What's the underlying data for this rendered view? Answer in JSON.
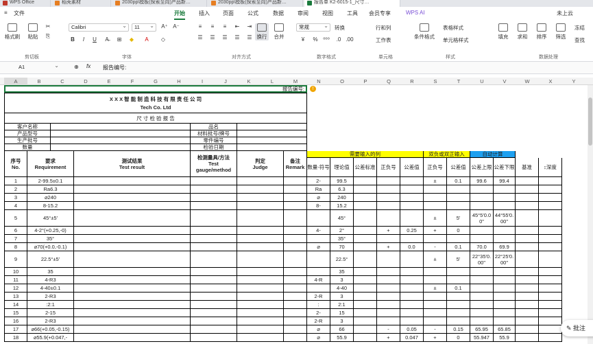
{
  "tabs": [
    {
      "label": "WPS Office",
      "color": "#c0392b"
    },
    {
      "label": "稻壳素材",
      "color": "#e67e22"
    },
    {
      "label": "2030pp\\模板(探索至向)产品新…",
      "color": "#e67e22"
    },
    {
      "label": "2030pp\\模板(探索至向)产品新…",
      "color": "#e67e22"
    },
    {
      "label": "报告单 K2-6015-1_尺寸…",
      "color": "#1a7a3c"
    }
  ],
  "menu": {
    "file": "文件",
    "items": [
      "开始",
      "插入",
      "页面",
      "公式",
      "数据",
      "审阅",
      "视图",
      "工具",
      "会员专享"
    ],
    "ai": "WPS AI",
    "cloud": "未上云",
    "active": "开始"
  },
  "ribbon": {
    "paste_group": [
      "格式刷",
      "粘贴",
      "剪切板"
    ],
    "font_name": "Calibri",
    "font_size": "11",
    "font_group": "字体",
    "align": [
      "换行",
      "合并",
      "对齐方式"
    ],
    "number_format": "常规",
    "convert": "转换",
    "rows_cols": "行和列",
    "worksheet": "工作表",
    "cond_format": "条件格式",
    "table_style": "表格样式",
    "cell_style": "单元格样式",
    "number_group": "数字格式",
    "cell_group": "单元格",
    "style_group": "样式",
    "fill": "填充",
    "sum": "求和",
    "sort": "排序",
    "filter": "筛选",
    "freeze": "冻结",
    "find": "查找",
    "data_group": "数据处理"
  },
  "formula_bar": {
    "cell_ref": "A1",
    "fx": "fx",
    "content": "报告编号:"
  },
  "columns": [
    "A",
    "B",
    "C",
    "D",
    "E",
    "F",
    "G",
    "H",
    "I",
    "J",
    "K",
    "L",
    "M",
    "N",
    "O",
    "P",
    "Q",
    "R",
    "S",
    "T",
    "U",
    "V",
    "W",
    "X",
    "Y"
  ],
  "sheet": {
    "report_no": "报告编号:",
    "company_cn": "X X X 智 能 制 造 科 技 有 限 责 任 公 司",
    "company_en": "Tech Co. Ltd",
    "title": "尺 寸 检 验 报 告",
    "info_left": [
      "客户名称",
      "产品型号",
      "生产批号",
      "数量"
    ],
    "info_right": [
      "品名",
      "材料批号/牌号",
      "零件编号",
      "检验日期"
    ],
    "hdr": {
      "seq": "序号\nNo.",
      "req": "要求\nRequirement",
      "result": "测试结果\nTest result",
      "gauge": "检测量具/方法\nTest\ngauge/method",
      "judge": "判定\nJudge",
      "remark": "备注\nRemark"
    },
    "band_yellow": "需要输入的列",
    "band_yellow2": "双负或双正输入",
    "band_blue": "自动计算",
    "sub_hdr": [
      "数量-符号",
      "理论值",
      "公差标准",
      "正负号",
      "公差值",
      "正负号",
      "公差值",
      "公差上限",
      "公差下限",
      "基准",
      "↕深度"
    ],
    "rows": [
      {
        "no": "1",
        "req": "2-99.5±0.1",
        "n": "2-",
        "o": "99.5",
        "p": "",
        "q": "",
        "r": "",
        "s": "±",
        "t": "0.1",
        "u": "99.6",
        "v": "99.4"
      },
      {
        "no": "2",
        "req": "Ra6.3",
        "n": "Ra",
        "o": "6.3",
        "p": "",
        "q": "",
        "r": "",
        "s": "",
        "t": "",
        "u": "",
        "v": ""
      },
      {
        "no": "3",
        "req": "⌀240",
        "n": "⌀",
        "o": "240",
        "p": "",
        "q": "",
        "r": "",
        "s": "",
        "t": "",
        "u": "",
        "v": ""
      },
      {
        "no": "4",
        "req": "8-15.2",
        "n": "8-",
        "o": "15.2",
        "p": "",
        "q": "",
        "r": "",
        "s": "",
        "t": "",
        "u": "",
        "v": ""
      },
      {
        "no": "5",
        "req": "45°±5'",
        "n": "",
        "o": "45°",
        "p": "",
        "q": "",
        "r": "",
        "s": "±",
        "t": "5'",
        "u": "45°5'0.0\n0\"",
        "v": "44°55'0.\n00\""
      },
      {
        "no": "6",
        "req": "4-2°(+0.25,-0)",
        "n": "4-",
        "o": "2°",
        "p": "",
        "q": "+",
        "r": "0.25",
        "s": "+",
        "t": "0",
        "u": "",
        "v": ""
      },
      {
        "no": "7",
        "req": "35°",
        "n": "",
        "o": "35°",
        "p": "",
        "q": "",
        "r": "",
        "s": "",
        "t": "",
        "u": "",
        "v": ""
      },
      {
        "no": "8",
        "req": "⌀70(+0.0,-0.1)",
        "n": "⌀",
        "o": "70",
        "p": "",
        "q": "+",
        "r": "0.0",
        "s": "-",
        "t": "0.1",
        "u": "70.0",
        "v": "69.9"
      },
      {
        "no": "9",
        "req": "22.5°±5'",
        "n": "",
        "o": "22.5°",
        "p": "",
        "q": "",
        "r": "",
        "s": "±",
        "t": "5'",
        "u": "22°35'0.\n00\"",
        "v": "22°25'0.\n00\""
      },
      {
        "no": "10",
        "req": "35",
        "n": "",
        "o": "35",
        "p": "",
        "q": "",
        "r": "",
        "s": "",
        "t": "",
        "u": "",
        "v": ""
      },
      {
        "no": "11",
        "req": "4-R3",
        "n": "4-R",
        "o": "3",
        "p": "",
        "q": "",
        "r": "",
        "s": "",
        "t": "",
        "u": "",
        "v": ""
      },
      {
        "no": "12",
        "req": "4-40±0.1",
        "n": "",
        "o": "4-40",
        "p": "",
        "q": "",
        "r": "",
        "s": "±",
        "t": "0.1",
        "u": "",
        "v": ""
      },
      {
        "no": "13",
        "req": "2-R3",
        "n": "2-R",
        "o": "3",
        "p": "",
        "q": "",
        "r": "",
        "s": "",
        "t": "",
        "u": "",
        "v": ""
      },
      {
        "no": "14",
        "req": ":2:1",
        "n": ":",
        "o": "2:1",
        "p": "",
        "q": "",
        "r": "",
        "s": "",
        "t": "",
        "u": "",
        "v": ""
      },
      {
        "no": "15",
        "req": "2-15",
        "n": "2-",
        "o": "15",
        "p": "",
        "q": "",
        "r": "",
        "s": "",
        "t": "",
        "u": "",
        "v": ""
      },
      {
        "no": "16",
        "req": "2-R3",
        "n": "2-R",
        "o": "3",
        "p": "",
        "q": "",
        "r": "",
        "s": "",
        "t": "",
        "u": "",
        "v": ""
      },
      {
        "no": "17",
        "req": "⌀66(+0.05,-0.15)",
        "n": "⌀",
        "o": "66",
        "p": "",
        "q": "-",
        "r": "0.05",
        "s": "-",
        "t": "0.15",
        "u": "65.95",
        "v": "65.85"
      },
      {
        "no": "18",
        "req": "⌀55.9(+0.047,-",
        "n": "⌀",
        "o": "55.9",
        "p": "",
        "q": "+",
        "r": "0.047",
        "s": "+",
        "t": "0",
        "u": "55.947",
        "v": "55.9"
      }
    ]
  },
  "comment_button": "批注",
  "colors": {
    "accent": "#1a7a3c",
    "yellow": "#ffff00",
    "blue": "#1ea0f0",
    "selection": "#1a7a3c"
  }
}
